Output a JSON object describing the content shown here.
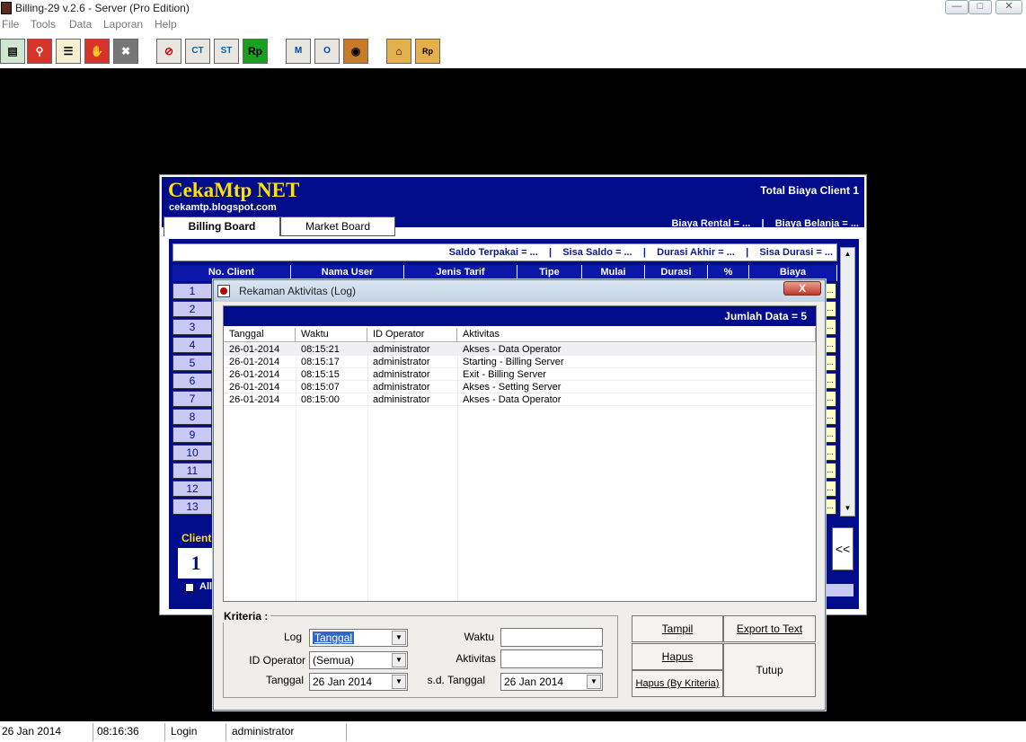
{
  "app": {
    "title": "Billing-29 v.2.6 - Server (Pro Edition)"
  },
  "menu": [
    "File",
    "Tools",
    "Data",
    "Laporan",
    "Help"
  ],
  "toolbar": {
    "buttons": [
      {
        "icon": "calculator-icon",
        "label": ""
      },
      {
        "icon": "key-icon",
        "label": ""
      },
      {
        "icon": "document-icon",
        "label": ""
      },
      {
        "icon": "handshake-icon",
        "label": ""
      },
      {
        "icon": "close-x-icon",
        "label": ""
      },
      {
        "icon": "no-entry-icon",
        "label": ""
      },
      {
        "icon": "ct-client-icon",
        "label": ""
      },
      {
        "icon": "st-status-icon",
        "label": ""
      },
      {
        "icon": "rupiah-icon",
        "label": "Rp"
      },
      {
        "icon": "member-icon",
        "label": ""
      },
      {
        "icon": "operator-icon",
        "label": ""
      },
      {
        "icon": "burger-icon",
        "label": ""
      },
      {
        "icon": "home-icon",
        "label": ""
      },
      {
        "icon": "home-rupiah-icon",
        "label": ""
      }
    ]
  },
  "billing": {
    "brand": "CekaMtp NET",
    "site": "cekamtp.blogspot.com",
    "total_label": "Total Biaya Client 1",
    "biaya_line": "Biaya Rental = ...    |    Biaya Belanja = ...",
    "tabs": [
      "Billing Board",
      "Market Board"
    ],
    "saldo_line": "Saldo Terpakai = ...    |    Sisa Saldo = ...    |    Durasi Akhir = ...    |    Sisa Durasi = ...",
    "columns": [
      "No. Client",
      "Nama User",
      "Jenis Tarif",
      "Tipe",
      "Mulai",
      "Durasi",
      "%",
      "Biaya"
    ],
    "rows": [
      "1",
      "2",
      "3",
      "4",
      "5",
      "6",
      "7",
      "8",
      "9",
      "10",
      "11",
      "12",
      "13"
    ],
    "ellipsis": "...",
    "client_label": "Client",
    "client_number": "1",
    "all_label": "All",
    "collapse_label": "<<"
  },
  "dialog": {
    "title": "Rekaman Aktivitas (Log)",
    "close_label": "X",
    "jumlah_label": "Jumlah Data = 5",
    "columns": [
      "Tanggal",
      "Waktu",
      "ID Operator",
      "Aktivitas"
    ],
    "rows": [
      {
        "tanggal": "26-01-2014",
        "waktu": "08:15:21",
        "operator": "administrator",
        "aktivitas": "Akses - Data Operator"
      },
      {
        "tanggal": "26-01-2014",
        "waktu": "08:15:17",
        "operator": "administrator",
        "aktivitas": "Starting - Billing Server"
      },
      {
        "tanggal": "26-01-2014",
        "waktu": "08:15:15",
        "operator": "administrator",
        "aktivitas": "Exit - Billing Server"
      },
      {
        "tanggal": "26-01-2014",
        "waktu": "08:15:07",
        "operator": "administrator",
        "aktivitas": "Akses - Setting Server"
      },
      {
        "tanggal": "26-01-2014",
        "waktu": "08:15:00",
        "operator": "administrator",
        "aktivitas": "Akses - Data Operator"
      }
    ],
    "kriteria": {
      "title": "Kriteria :",
      "log_label": "Log",
      "log_value": "Tanggal",
      "operator_label": "ID Operator",
      "operator_value": "(Semua)",
      "tanggal_label": "Tanggal",
      "tanggal_value": "26 Jan 2014",
      "waktu_label": "Waktu",
      "waktu_value": "",
      "aktivitas_label": "Aktivitas",
      "aktivitas_value": "",
      "sd_label": "s.d. Tanggal",
      "sd_value": "26 Jan 2014"
    },
    "buttons": {
      "tampil": "Tampil",
      "export": "Export to Text",
      "hapus": "Hapus",
      "hapus_kriteria": "Hapus (By Kriteria)",
      "tutup": "Tutup"
    }
  },
  "status": {
    "date": "26 Jan 2014",
    "time": "08:16:36",
    "mode": "Login",
    "user": "administrator"
  }
}
